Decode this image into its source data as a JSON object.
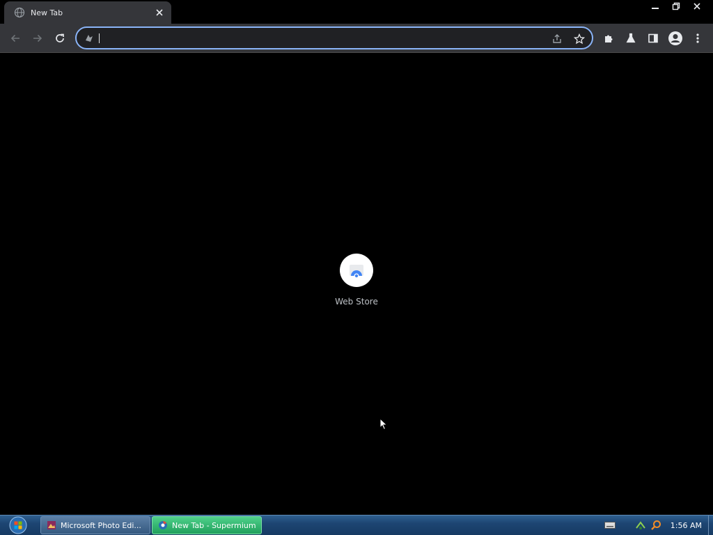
{
  "browser": {
    "tab": {
      "title": "New Tab",
      "favicon": "globe-icon",
      "close_icon": "close-icon"
    },
    "window_controls": [
      "minimize-icon",
      "restore-icon",
      "close-icon"
    ],
    "toolbar": {
      "back_icon": "back-arrow-icon",
      "forward_icon": "forward-arrow-icon",
      "reload_icon": "reload-icon",
      "omnibox": {
        "value": "",
        "security_icon": "search-engine-icon",
        "share_icon": "share-icon",
        "bookmark_icon": "star-icon"
      },
      "extensions_icon": "puzzle-icon",
      "labs_icon": "flask-icon",
      "side_panel_icon": "side-panel-icon",
      "profile_icon": "avatar-icon",
      "menu_icon": "kebab-menu-icon"
    },
    "accent_color": "#8ab4f8"
  },
  "new_tab_page": {
    "shortcuts": [
      {
        "label": "Web Store",
        "icon": "web-store-icon"
      }
    ]
  },
  "taskbar": {
    "start_icon": "windows-orb-icon",
    "items": [
      {
        "label": "Microsoft Photo Edi...",
        "icon": "photo-editor-icon",
        "active": false
      },
      {
        "label": "New Tab - Supermium",
        "icon": "supermium-icon",
        "active": true
      }
    ],
    "tray_icons": [
      "keyboard-icon",
      "network-icon",
      "search-icon"
    ],
    "clock": "1:56 AM"
  }
}
